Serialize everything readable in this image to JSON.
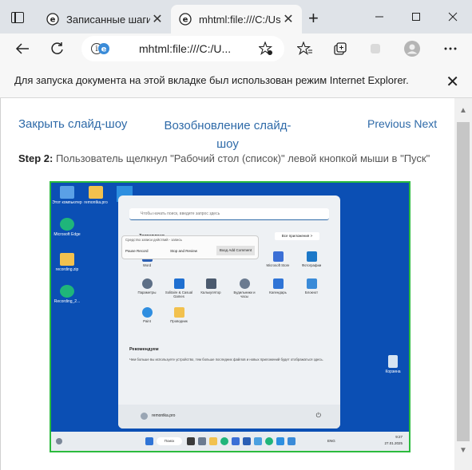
{
  "browser": {
    "tabs": [
      {
        "label": "Записанные шаги",
        "icon": "edge-ie-mode-icon"
      },
      {
        "label": "mhtml:file:///C:/Us",
        "icon": "edge-ie-mode-icon",
        "active": true
      }
    ],
    "address": "mhtml:file:///C:/U...",
    "accent": "#2e6aa8"
  },
  "infobar": {
    "message": "Для запуска документа на этой вкладке был использован режим Internet Explorer."
  },
  "page": {
    "close_slideshow": "Закрыть слайд-шоу",
    "resume_slideshow": "Возобновление слайд-шоу",
    "previous_next": "Previous Next",
    "step_label": "Step 2:",
    "step_text": " Пользователь щелкнул \"Рабочий стол (список)\" левой кнопкой мыши в \"Пуск\""
  },
  "screenshot": {
    "desktop_icons": [
      {
        "label": "Этот компьютер",
        "color": "#5aa0e6"
      },
      {
        "label": "remontka.pro",
        "color": "#f2c14e"
      },
      {
        "label": "Microsoft Edge",
        "color": "#1fb57a"
      },
      {
        "label": "recording.zip",
        "color": "#f2c14e"
      },
      {
        "label": "Recording_2...",
        "color": "#1fb57a"
      }
    ],
    "start_menu": {
      "search_placeholder": "Чтобы начать поиск, введите запрос здесь",
      "pinned_title": "Закреплено",
      "all_apps": "Все приложения  >",
      "apps": [
        "Word",
        "Excel",
        "Edge",
        "Microsoft Store",
        "Фотографии",
        "Параметры",
        "Solitaire & Casual Games",
        "Калькулятор",
        "Будильники и часы",
        "Календарь",
        "Блокнот",
        "Paint",
        "Проводник"
      ],
      "recommended_title": "Рекомендуем",
      "recommended_text": "Чем больше вы используете устройство, тем больше последних файлов и новых приложений будет отображаться здесь.",
      "user": "remontka.pro"
    },
    "recorder": {
      "title": "Средство записи действий - запись",
      "pause": "Pause Record",
      "stop": "Stop and Review",
      "comment": "Вход Add Comment"
    },
    "taskbar": {
      "search": "Поиск",
      "lang": "ENG",
      "time": "9:27",
      "date": "27.01.2025"
    },
    "recycle_bin": "Корзина"
  }
}
